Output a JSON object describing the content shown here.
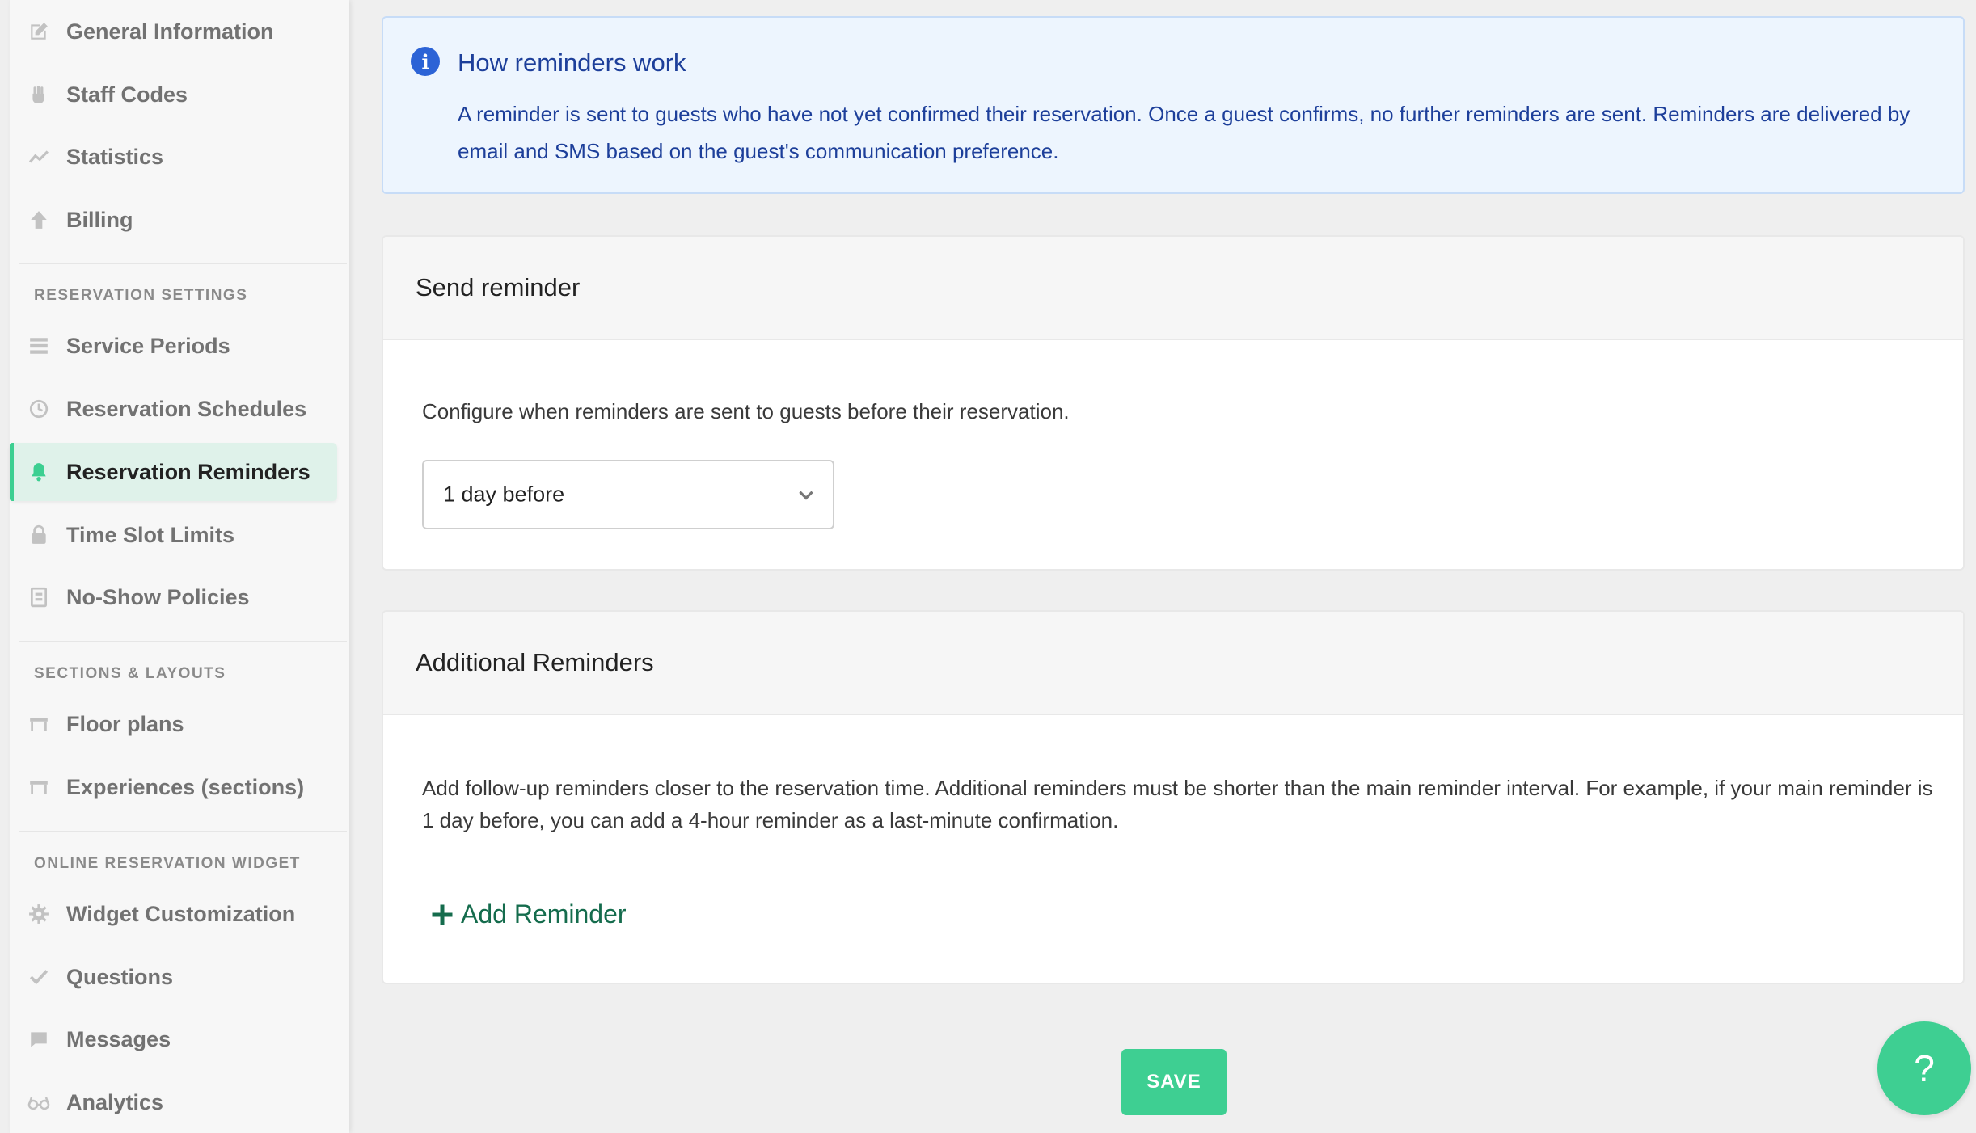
{
  "sidebar": {
    "items_top": [
      {
        "label": "General Information",
        "icon": "edit-icon"
      },
      {
        "label": "Staff Codes",
        "icon": "hand-icon"
      },
      {
        "label": "Statistics",
        "icon": "chart-line-icon"
      },
      {
        "label": "Billing",
        "icon": "upload-icon"
      }
    ],
    "section_reservation": "RESERVATION SETTINGS",
    "items_reservation": [
      {
        "label": "Service Periods",
        "icon": "list-icon"
      },
      {
        "label": "Reservation Schedules",
        "icon": "clock-icon"
      },
      {
        "label": "Reservation Reminders",
        "icon": "bell-icon",
        "active": true
      },
      {
        "label": "Time Slot Limits",
        "icon": "lock-icon"
      },
      {
        "label": "No-Show Policies",
        "icon": "document-icon"
      }
    ],
    "section_sections": "SECTIONS & LAYOUTS",
    "items_sections": [
      {
        "label": "Floor plans",
        "icon": "table-icon"
      },
      {
        "label": "Experiences (sections)",
        "icon": "table-icon"
      }
    ],
    "section_widget": "ONLINE RESERVATION WIDGET",
    "items_widget": [
      {
        "label": "Widget Customization",
        "icon": "gear-icon"
      },
      {
        "label": "Questions",
        "icon": "check-icon"
      },
      {
        "label": "Messages",
        "icon": "message-icon"
      },
      {
        "label": "Analytics",
        "icon": "glasses-icon"
      }
    ]
  },
  "info": {
    "title": "How reminders work",
    "text": "A reminder is sent to guests who have not yet confirmed their reservation. Once a guest confirms, no further reminders are sent. Reminders are delivered by email and SMS based on the guest's communication preference."
  },
  "send_reminder": {
    "title": "Send reminder",
    "description": "Configure when reminders are sent to guests before their reservation.",
    "selected": "1 day before"
  },
  "additional": {
    "title": "Additional Reminders",
    "description": "Add follow-up reminders closer to the reservation time. Additional reminders must be shorter than the main reminder interval. For example, if your main reminder is 1 day before, you can add a 4-hour reminder as a last-minute confirmation.",
    "add_label": "Add Reminder"
  },
  "save_label": "SAVE",
  "help_label": "?",
  "colors": {
    "accent": "#3ecf92",
    "info_text": "#1d3f9a",
    "link_green": "#156c4d"
  }
}
